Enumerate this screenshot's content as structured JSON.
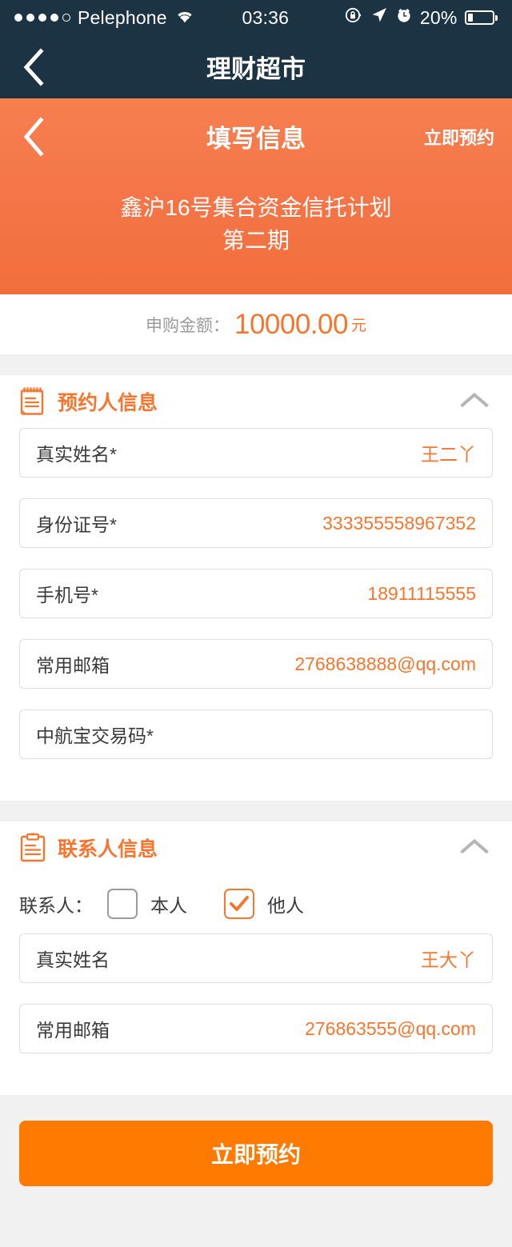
{
  "status_bar": {
    "carrier": "Pelephone",
    "time": "03:36",
    "battery_percent": "20%",
    "signal_dots_filled": 4,
    "signal_dots_total": 5,
    "icons": [
      "wifi-icon",
      "rotation-lock-icon",
      "location-arrow-icon",
      "alarm-clock-icon",
      "battery-icon"
    ]
  },
  "app_nav": {
    "back_label": "‹",
    "title": "理财超市"
  },
  "page_header": {
    "back_label": "‹",
    "title": "填写信息",
    "action_label": "立即预约",
    "product_line1": "鑫沪16号集合资金信托计划",
    "product_line2": "第二期"
  },
  "amount": {
    "label": "申购金额：",
    "value": "10000.00",
    "unit": "元"
  },
  "applicant_section": {
    "icon": "notepad-icon",
    "title": "预约人信息",
    "collapse_icon": "chevron-up-icon",
    "fields": [
      {
        "label": "真实姓名*",
        "value": "王二丫"
      },
      {
        "label": "身份证号*",
        "value": "333355558967352"
      },
      {
        "label": "手机号*",
        "value": "18911115555"
      },
      {
        "label": "常用邮箱",
        "value": "2768638888@qq.com"
      },
      {
        "label": "中航宝交易码*",
        "value": ""
      }
    ]
  },
  "contact_section": {
    "icon": "clipboard-icon",
    "title": "联系人信息",
    "collapse_icon": "chevron-up-icon",
    "choice_label": "联系人：",
    "options": [
      {
        "label": "本人",
        "checked": false
      },
      {
        "label": "他人",
        "checked": true
      }
    ],
    "fields": [
      {
        "label": "真实姓名",
        "value": "王大丫"
      },
      {
        "label": "常用邮箱",
        "value": "276863555@qq.com"
      }
    ]
  },
  "cta": {
    "label": "立即预约"
  },
  "colors": {
    "navy": "#1c3344",
    "orange_header_top": "#f7804f",
    "orange_header_bottom": "#f26f3b",
    "accent_orange": "#f4762f",
    "cta_orange": "#ff7a00",
    "page_bg": "#f1f1f1"
  }
}
